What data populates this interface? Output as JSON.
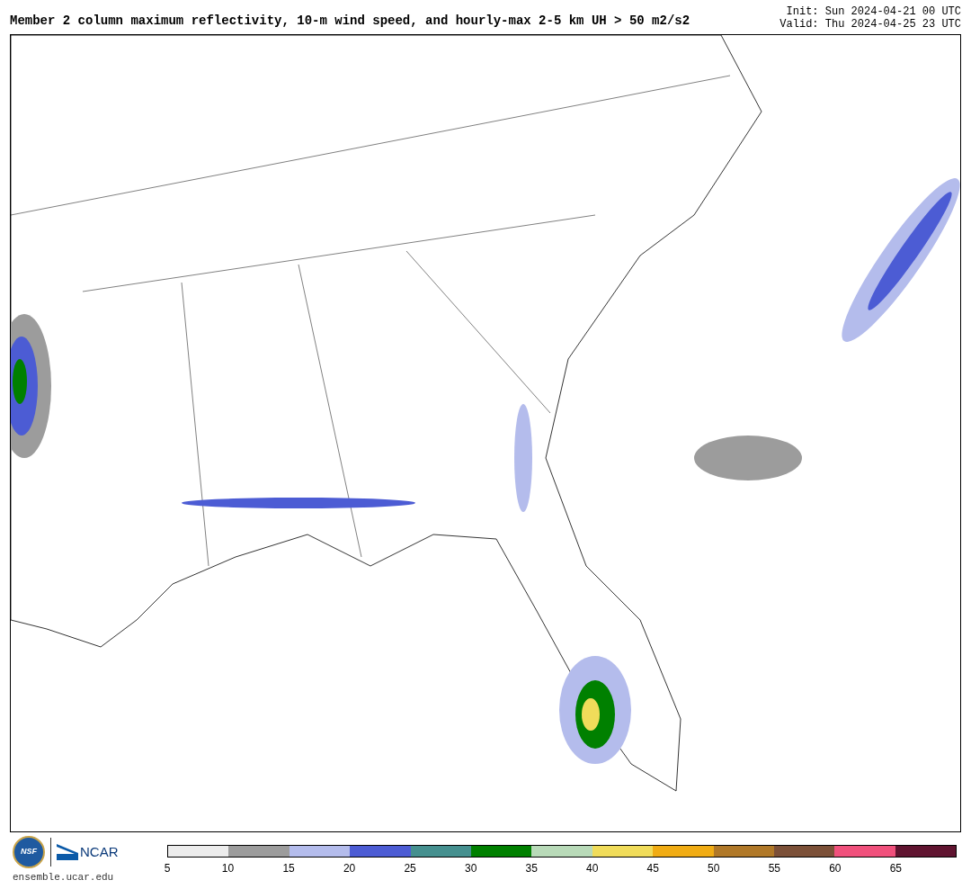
{
  "title": "Member 2 column maximum reflectivity, 10-m wind speed, and hourly-max 2-5 km UH > 50 m2/s2",
  "init": "Init: Sun 2024-04-21 00 UTC",
  "valid": "Valid: Thu 2024-04-25 23 UTC",
  "logos": {
    "nsf": "NSF",
    "ncar": "NCAR"
  },
  "site": "ensemble.ucar.edu",
  "colorbar": {
    "bins": [
      {
        "color": "#ececec",
        "label": "5"
      },
      {
        "color": "#9c9c9c",
        "label": "10"
      },
      {
        "color": "#b4bcec",
        "label": "15"
      },
      {
        "color": "#4c5cd4",
        "label": "20"
      },
      {
        "color": "#45908f",
        "label": "25"
      },
      {
        "color": "#008000",
        "label": "30"
      },
      {
        "color": "#b8dab8",
        "label": "35"
      },
      {
        "color": "#f0dc5a",
        "label": "40"
      },
      {
        "color": "#f0ac14",
        "label": "45"
      },
      {
        "color": "#b07828",
        "label": "50"
      },
      {
        "color": "#7c5038",
        "label": "55"
      },
      {
        "color": "#f0507c",
        "label": "60"
      },
      {
        "color": "#601430",
        "label": "65"
      }
    ]
  }
}
